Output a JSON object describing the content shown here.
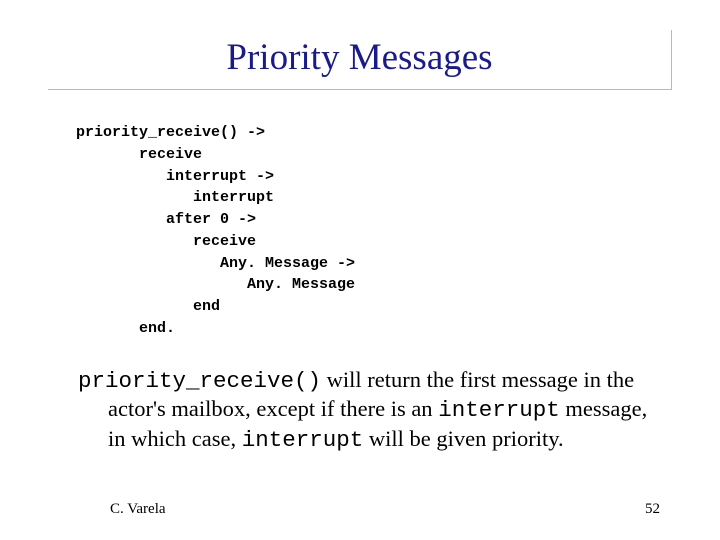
{
  "title": "Priority Messages",
  "code": "priority_receive() ->\n       receive\n          interrupt ->\n             interrupt\n          after 0 ->\n             receive\n                Any. Message ->\n                   Any. Message\n             end\n       end.",
  "desc": {
    "p1": "priority_receive()",
    "p2": " will return the first message in the actor's mailbox, except if there is an ",
    "p3": "interrupt",
    "p4": " message, in which case, ",
    "p5": "interrupt",
    "p6": " will be given priority."
  },
  "footer": {
    "author": "C. Varela",
    "page": "52"
  }
}
